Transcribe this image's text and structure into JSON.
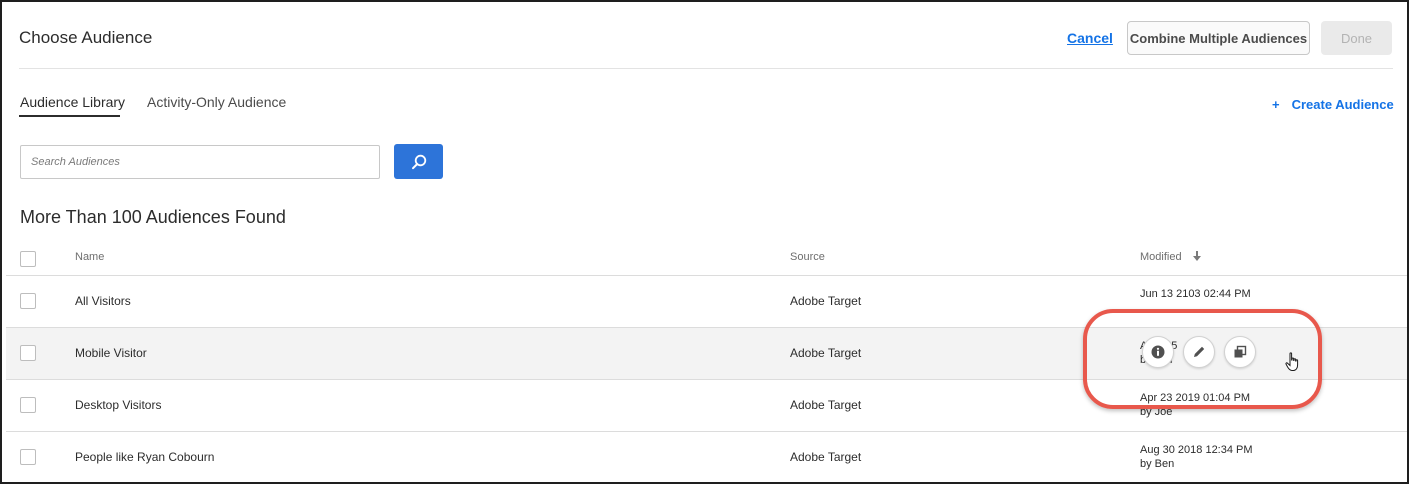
{
  "header": {
    "title": "Choose Audience",
    "cancel_label": "Cancel",
    "combine_label": "Combine Multiple Audiences",
    "done_label": "Done"
  },
  "tabs": [
    {
      "label": "Audience Library",
      "active": true
    },
    {
      "label": "Activity-Only Audience",
      "active": false
    }
  ],
  "create_audience": {
    "icon": "plus-icon",
    "plus": "+",
    "label": "Create Audience"
  },
  "search": {
    "placeholder": "Search Audiences",
    "value": "",
    "button_icon": "search-icon"
  },
  "results_summary": "More Than 100 Audiences Found",
  "table": {
    "columns": {
      "name": "Name",
      "source": "Source",
      "modified": "Modified"
    },
    "sort": {
      "column": "Modified",
      "direction": "descending",
      "icon": "arrow-down-icon"
    },
    "rows": [
      {
        "name": "All Visitors",
        "source": "Adobe Target",
        "modified_date": "Jun 13 2103  02:44 PM",
        "modified_by": ""
      },
      {
        "name": "Mobile Visitor",
        "source": "Adobe Target",
        "modified_date": "A   20   05",
        "modified_by": "b   Ro   n",
        "hovered": true
      },
      {
        "name": "Desktop Visitors",
        "source": "Adobe Target",
        "modified_date": "Apr 23 2019  01:04 PM",
        "modified_by": "by Joe"
      },
      {
        "name": "People like Ryan Cobourn",
        "source": "Adobe Target",
        "modified_date": "Aug 30 2018  12:34 PM",
        "modified_by": "by Ben"
      }
    ]
  },
  "row_actions": [
    {
      "icon": "info-icon"
    },
    {
      "icon": "edit-pencil-icon"
    },
    {
      "icon": "copy-icon"
    }
  ],
  "colors": {
    "accent": "#1473e6",
    "search_button": "#2d74d9",
    "highlight": "#e8584c",
    "hover_row": "#f3f3f3"
  }
}
